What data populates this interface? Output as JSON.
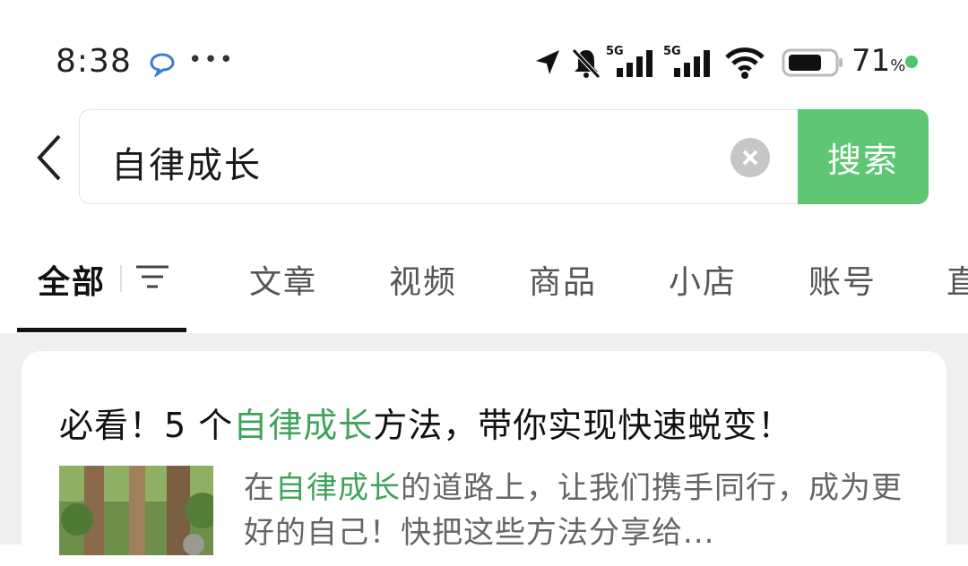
{
  "status_bar": {
    "time": "8:38",
    "battery_percent": "71",
    "battery_unit": "%",
    "network_1": "5G",
    "network_2": "5G"
  },
  "search": {
    "query": "自律成长",
    "button_label": "搜索"
  },
  "tabs": [
    {
      "label": "全部",
      "active": true
    },
    {
      "label": "文章",
      "active": false
    },
    {
      "label": "视频",
      "active": false
    },
    {
      "label": "商品",
      "active": false
    },
    {
      "label": "小店",
      "active": false
    },
    {
      "label": "账号",
      "active": false
    },
    {
      "label": "直",
      "active": false
    }
  ],
  "result": {
    "title_pre": "必看！5 个",
    "title_hl": "自律成长",
    "title_post": "方法，带你实现快速蜕变！",
    "snippet_pre": "在",
    "snippet_hl": "自律成长",
    "snippet_post": "的道路上，让我们携手同行，成为更好的自己！快把这些方法分享给..."
  },
  "colors": {
    "accent_green": "#5fc673",
    "highlight_green": "#3fa35a"
  }
}
